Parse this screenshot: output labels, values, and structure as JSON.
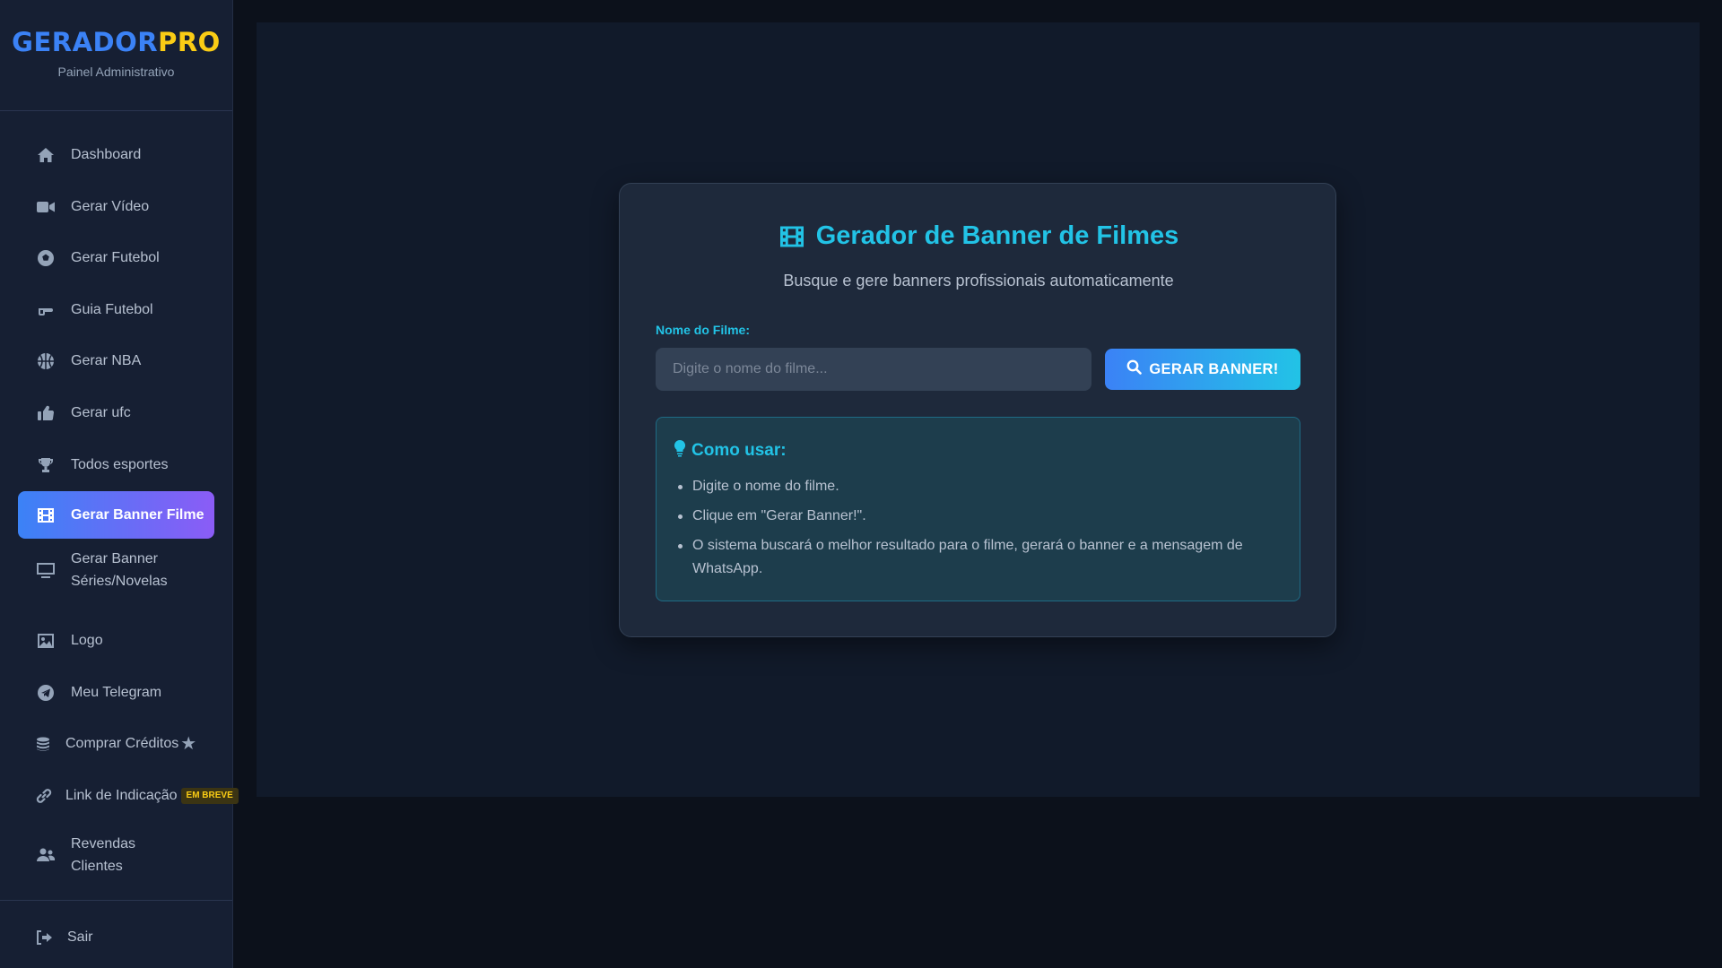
{
  "brand": {
    "name_part1": "GERADOR",
    "name_part2": "PRO",
    "subtitle": "Painel Administrativo"
  },
  "sidebar": {
    "items": [
      {
        "label": "Dashboard",
        "icon": "home-icon"
      },
      {
        "label": "Gerar Vídeo",
        "icon": "video-camera-icon"
      },
      {
        "label": "Gerar Futebol",
        "icon": "soccer-ball-icon"
      },
      {
        "label": "Guia Futebol",
        "icon": "hand-pointing-icon"
      },
      {
        "label": "Gerar NBA",
        "icon": "basketball-icon"
      },
      {
        "label": "Gerar ufc",
        "icon": "thumbs-up-icon"
      },
      {
        "label": "Todos esportes",
        "icon": "trophy-icon"
      },
      {
        "label": "Gerar Banner Filme",
        "icon": "film-icon",
        "active": true
      },
      {
        "label": "Gerar Banner Séries/Novelas",
        "icon": "tv-icon"
      },
      {
        "label": "Logo",
        "icon": "image-icon"
      },
      {
        "label": "Meu Telegram",
        "icon": "telegram-icon"
      },
      {
        "label": "Comprar Créditos",
        "icon": "coins-icon",
        "badge_icon": "star-icon"
      },
      {
        "label": "Link de Indicação",
        "icon": "link-icon",
        "badge": "EM BREVE"
      },
      {
        "label": "Revendas Clientes",
        "icon": "users-icon"
      }
    ],
    "logout": {
      "label": "Sair",
      "icon": "sign-out-icon"
    }
  },
  "main": {
    "title": "Gerador de Banner de Filmes",
    "subtitle": "Busque e gere banners profissionais automaticamente",
    "field_label": "Nome do Filme:",
    "input": {
      "value": "",
      "placeholder": "Digite o nome do filme..."
    },
    "button_label": "GERAR BANNER!",
    "howto": {
      "title": "Como usar:",
      "steps": [
        "Digite o nome do filme.",
        "Clique em \"Gerar Banner!\".",
        "O sistema buscará o melhor resultado para o filme, gerará o banner e a mensagem de WhatsApp."
      ]
    }
  },
  "colors": {
    "accent_cyan": "#22c3e6",
    "accent_blue": "#3b82f6",
    "accent_purple": "#8b5cf6",
    "brand_yellow": "#facc15"
  }
}
